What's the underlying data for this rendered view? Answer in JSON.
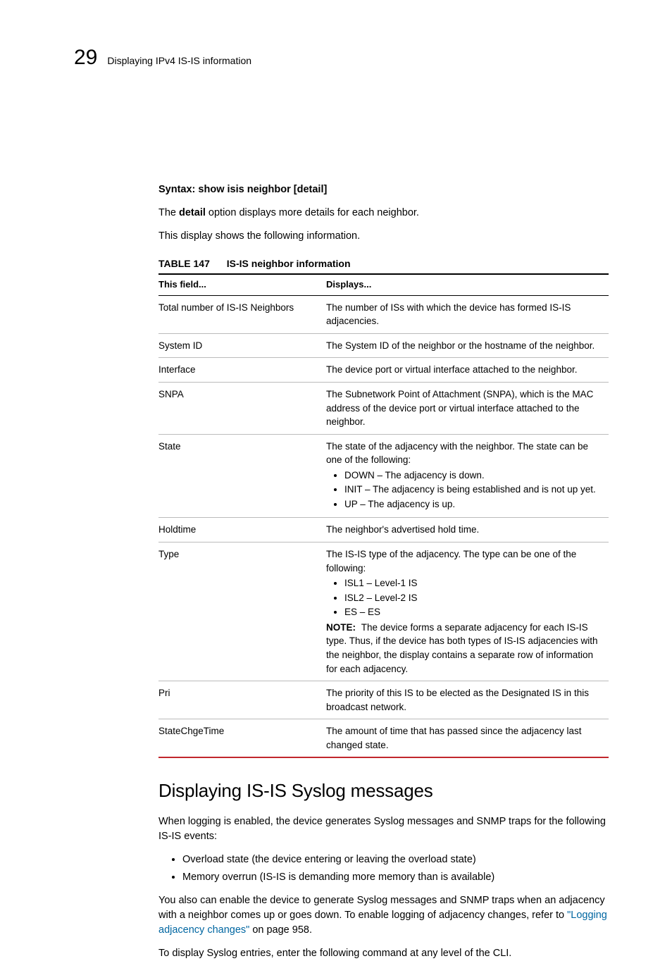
{
  "header": {
    "chapter_number": "29",
    "running_title": "Displaying IPv4 IS-IS information"
  },
  "syntax": {
    "label": "Syntax:",
    "command": "show isis neighbor [detail]"
  },
  "intro": {
    "p1_pre": "The ",
    "p1_bold": "detail",
    "p1_post": " option displays more details for each neighbor.",
    "p2": "This display shows the following information."
  },
  "table": {
    "caption_num": "TABLE 147",
    "caption_title": "IS-IS neighbor information",
    "head_field": "This field...",
    "head_disp": "Displays...",
    "rows": {
      "r0": {
        "f": "Total number of IS-IS Neighbors",
        "d": "The number of ISs with which the device has formed IS-IS adjacencies."
      },
      "r1": {
        "f": "System ID",
        "d": "The System ID of the neighbor or the hostname of the neighbor."
      },
      "r2": {
        "f": "Interface",
        "d": "The device port or virtual interface attached to the neighbor."
      },
      "r3": {
        "f": "SNPA",
        "d": "The Subnetwork Point of Attachment (SNPA), which is the MAC address of the device port or virtual interface attached to the neighbor."
      },
      "r4": {
        "f": "State",
        "d_lead": "The state of the adjacency with the neighbor.  The state can be one of the following:",
        "li0": "DOWN – The adjacency is down.",
        "li1": "INIT – The adjacency is being established and is not up yet.",
        "li2": "UP – The adjacency is up."
      },
      "r5": {
        "f": "Holdtime",
        "d": "The neighbor's advertised hold time."
      },
      "r6": {
        "f": "Type",
        "d_lead": "The IS-IS type of the adjacency. The type can be one of the following:",
        "li0": "ISL1 – Level-1 IS",
        "li1": "ISL2 – Level-2 IS",
        "li2": "ES – ES",
        "note_label": "NOTE:",
        "note_body": "The device forms a separate adjacency for each IS-IS type. Thus, if the device has both types of IS-IS adjacencies with the neighbor, the display contains a separate row of information for each adjacency."
      },
      "r7": {
        "f": "Pri",
        "d": "The priority of this IS to be elected as the Designated IS in this broadcast network."
      },
      "r8": {
        "f": "StateChgeTime",
        "d": "The amount of time that has passed since the adjacency last changed state."
      }
    }
  },
  "section": {
    "heading": "Displaying IS-IS Syslog messages",
    "p1": "When logging is enabled, the device generates Syslog messages and SNMP traps for the following IS-IS events:",
    "bul0": "Overload state (the device entering or leaving the overload state)",
    "bul1": "Memory overrun (IS-IS is demanding more memory than is available)",
    "p2_pre": "You also can enable the device to generate Syslog messages and SNMP traps when an adjacency with a neighbor comes up or goes down. To enable logging of adjacency changes, refer to ",
    "p2_link": "\"Logging adjacency changes\"",
    "p2_post": " on page 958.",
    "p3": "To display Syslog entries, enter the following command at any level of the CLI."
  }
}
